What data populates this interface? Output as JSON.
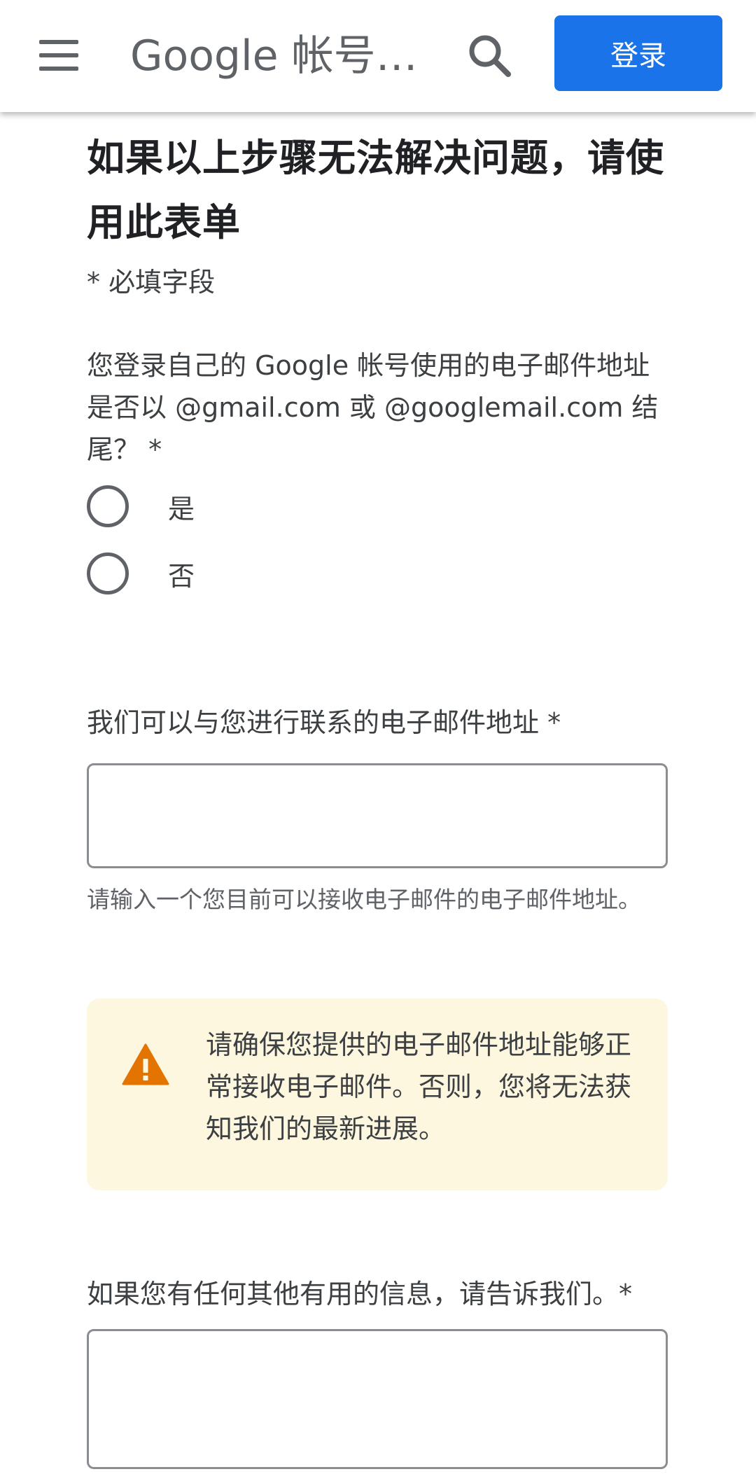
{
  "header": {
    "title": "Google 帐号帮助",
    "signin_label": "登录",
    "menu_icon": "hamburger-menu-icon",
    "search_icon": "search-icon",
    "accent_color": "#1a73e8"
  },
  "form": {
    "title": "如果以上步骤无法解决问题，请使用此表单",
    "required_note": "* 必填字段",
    "question_gmail": {
      "label": "您登录自己的 Google 帐号使用的电子邮件地址是否以 @gmail.com 或 @googlemail.com 结尾？ *",
      "options": [
        "是",
        "否"
      ]
    },
    "question_email": {
      "label": "我们可以与您进行联系的电子邮件地址 *",
      "value": "",
      "hint": "请输入一个您目前可以接收电子邮件的电子邮件地址。"
    },
    "warning": {
      "icon": "warning-icon",
      "text": "请确保您提供的电子邮件地址能够正常接收电子邮件。否则，您将无法获知我们的最新进展。",
      "color": "#e37400",
      "background": "#fef7e0"
    },
    "question_info": {
      "label": "如果您有任何其他有用的信息，请告诉我们。*",
      "value": ""
    }
  }
}
